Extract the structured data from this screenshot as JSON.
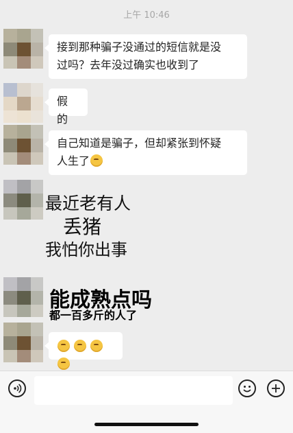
{
  "status": {
    "time": "上午 10:46"
  },
  "messages": [
    {
      "text_line1": "接到那种骗子没通过的短信就是没",
      "text_line2": "过吗？去年没过确实也收到了"
    },
    {
      "text": "假的"
    },
    {
      "text_line1": "自己知道是骗子，但却紧张到怀疑",
      "text_line2": "人生了"
    }
  ],
  "sticker_handwritten": {
    "line1": "最近老有人",
    "line2": "丢猪",
    "line3": "我怕你出事"
  },
  "sticker_bold": {
    "line1": "能成熟点吗",
    "line2": "都一百多斤的人了"
  },
  "emoji_message": {
    "emoji": "sweat-smile-emoji",
    "count": 4
  },
  "input_bar": {
    "placeholder": "",
    "voice_icon": "voice-icon",
    "emoji_icon": "emoji-icon",
    "plus_icon": "plus-icon"
  }
}
